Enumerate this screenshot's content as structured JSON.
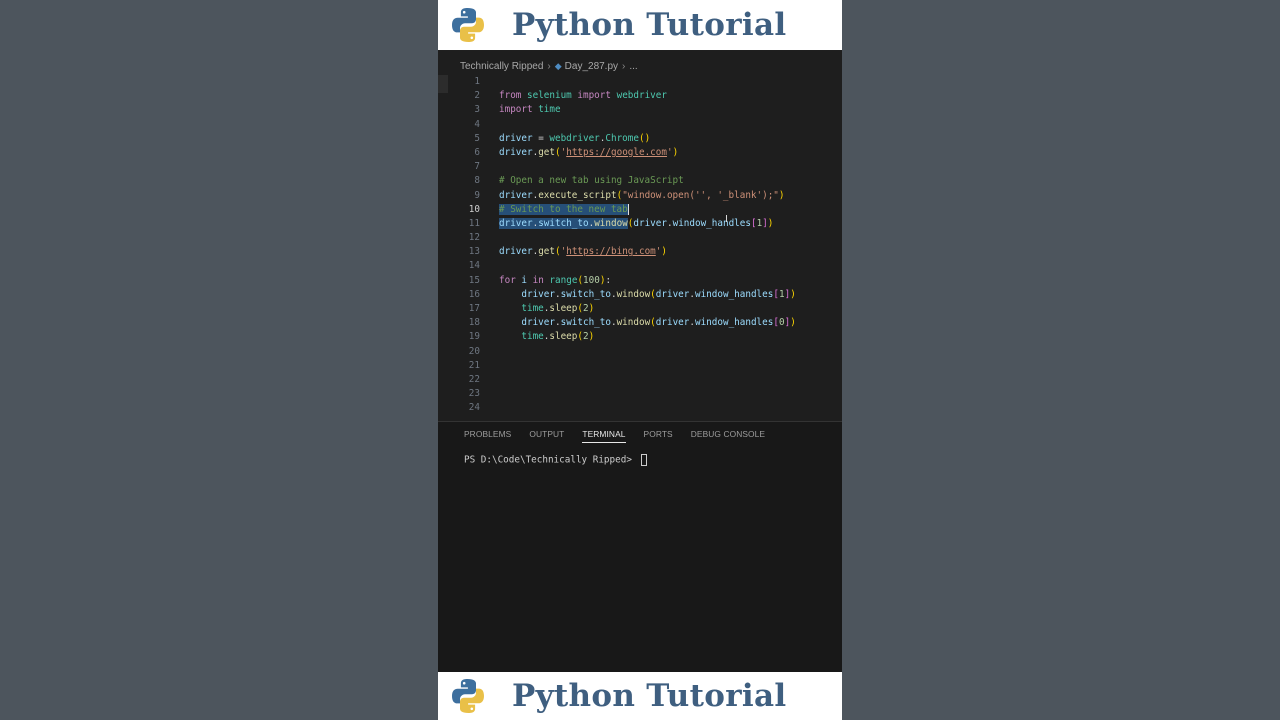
{
  "banner": {
    "title": "Python Tutorial",
    "logo_icon": "python-logo-icon"
  },
  "breadcrumb": {
    "folder": "Technically Ripped",
    "file": "Day_287.py",
    "ellipsis": "..."
  },
  "code_lines": [
    {
      "n": "1",
      "html": ""
    },
    {
      "n": "2",
      "html": "<span class=\"kw\">from</span> <span class=\"mod\">selenium</span> <span class=\"kw\">import</span> <span class=\"mod\">webdriver</span>"
    },
    {
      "n": "3",
      "html": "<span class=\"kw\">import</span> <span class=\"mod\">time</span>"
    },
    {
      "n": "4",
      "html": ""
    },
    {
      "n": "5",
      "html": "<span class=\"var\">driver</span> = <span class=\"mod\">webdriver</span>.<span class=\"mod\">Chrome</span><span class=\"bk1\">()</span>"
    },
    {
      "n": "6",
      "html": "<span class=\"var\">driver</span>.<span class=\"fn\">get</span><span class=\"bk1\">(</span><span class=\"str\">'</span><span class=\"url\">https://google.com</span><span class=\"str\">'</span><span class=\"bk1\">)</span>"
    },
    {
      "n": "7",
      "html": ""
    },
    {
      "n": "8",
      "html": "<span class=\"cmt\"># Open a new tab using JavaScript</span>"
    },
    {
      "n": "9",
      "html": "<span class=\"var\">driver</span>.<span class=\"fn\">execute_script</span><span class=\"bk1\">(</span><span class=\"str\">\"window.open('', '_blank');\"</span><span class=\"bk1\">)</span>"
    },
    {
      "n": "10",
      "html": "<span class=\"sel\"><span class=\"cmt\"># Switch to the new tab</span></span><span class=\"cursor\"></span>",
      "active": true
    },
    {
      "n": "11",
      "html": "<span class=\"sel\"><span class=\"var\">driver</span>.<span class=\"var\">switch_to</span>.<span class=\"fn\">window</span></span><span class=\"bk1\">(</span><span class=\"var\">driver</span>.<span class=\"var\">window_handles</span><span class=\"bk2\">[</span><span class=\"num\">1</span><span class=\"bk2\">]</span><span class=\"bk1\">)</span>"
    },
    {
      "n": "12",
      "html": ""
    },
    {
      "n": "13",
      "html": "<span class=\"var\">driver</span>.<span class=\"fn\">get</span><span class=\"bk1\">(</span><span class=\"str\">'</span><span class=\"url\">https://bing.com</span><span class=\"str\">'</span><span class=\"bk1\">)</span>"
    },
    {
      "n": "14",
      "html": ""
    },
    {
      "n": "15",
      "html": "<span class=\"kw\">for</span> <span class=\"var\">i</span> <span class=\"kw\">in</span> <span class=\"mod\">range</span><span class=\"bk1\">(</span><span class=\"num\">100</span><span class=\"bk1\">)</span>:"
    },
    {
      "n": "16",
      "html": "    <span class=\"var\">driver</span>.<span class=\"var\">switch_to</span>.<span class=\"fn\">window</span><span class=\"bk1\">(</span><span class=\"var\">driver</span>.<span class=\"var\">window_handles</span><span class=\"bk2\">[</span><span class=\"num\">1</span><span class=\"bk2\">]</span><span class=\"bk1\">)</span>"
    },
    {
      "n": "17",
      "html": "    <span class=\"mod\">time</span>.<span class=\"fn\">sleep</span><span class=\"bk1\">(</span><span class=\"num\">2</span><span class=\"bk1\">)</span>"
    },
    {
      "n": "18",
      "html": "    <span class=\"var\">driver</span>.<span class=\"var\">switch_to</span>.<span class=\"fn\">window</span><span class=\"bk1\">(</span><span class=\"var\">driver</span>.<span class=\"var\">window_handles</span><span class=\"bk2\">[</span><span class=\"num\">0</span><span class=\"bk2\">]</span><span class=\"bk1\">)</span>"
    },
    {
      "n": "19",
      "html": "    <span class=\"mod\">time</span>.<span class=\"fn\">sleep</span><span class=\"bk1\">(</span><span class=\"num\">2</span><span class=\"bk1\">)</span>"
    },
    {
      "n": "20",
      "html": ""
    },
    {
      "n": "21",
      "html": ""
    },
    {
      "n": "22",
      "html": ""
    },
    {
      "n": "23",
      "html": ""
    },
    {
      "n": "24",
      "html": ""
    }
  ],
  "panel": {
    "tabs": [
      "PROBLEMS",
      "OUTPUT",
      "TERMINAL",
      "PORTS",
      "DEBUG CONSOLE"
    ],
    "active_tab": "TERMINAL",
    "prompt": "PS D:\\Code\\Technically Ripped> "
  },
  "colors": {
    "banner_title": "#3f5f80",
    "editor_bg": "#1e1e1e",
    "panel_bg": "#181818",
    "selection": "#264f78"
  }
}
